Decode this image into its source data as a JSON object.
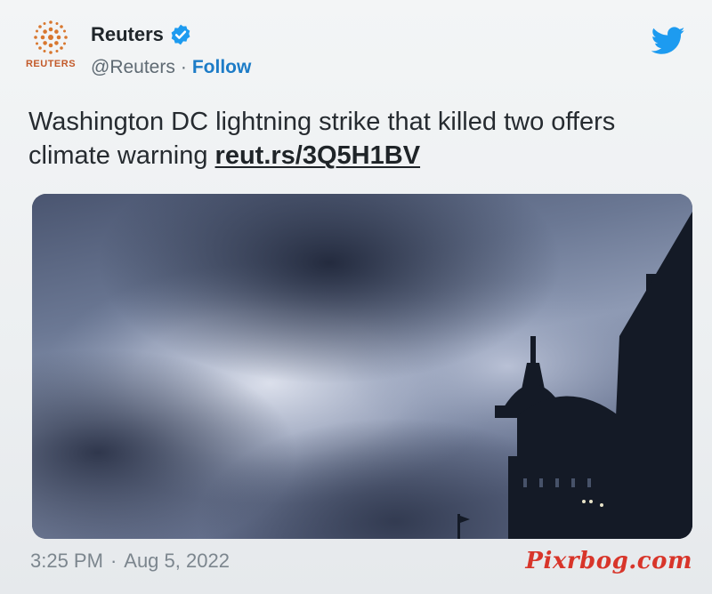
{
  "tweet": {
    "author": {
      "display_name": "Reuters",
      "avatar_label": "REUTERS",
      "handle": "@Reuters",
      "separator": "·",
      "follow_label": "Follow",
      "verified_icon": "verified-badge-icon"
    },
    "text": "Washington DC lightning strike that killed two offers climate warning",
    "link": "reut.rs/3Q5H1BV",
    "timestamp": {
      "time": "3:25 PM",
      "separator": "·",
      "date": "Aug 5, 2022"
    },
    "platform_icon": "twitter-bird-icon",
    "media_description_icon": "photo-capitol-dome-storm-clouds"
  },
  "watermark": "Pixrbog.com",
  "colors": {
    "link_blue": "#1d7cc7",
    "verified_blue": "#1d9bf0",
    "watermark_red": "#d8352a",
    "brand_orange": "#c35a2a"
  }
}
